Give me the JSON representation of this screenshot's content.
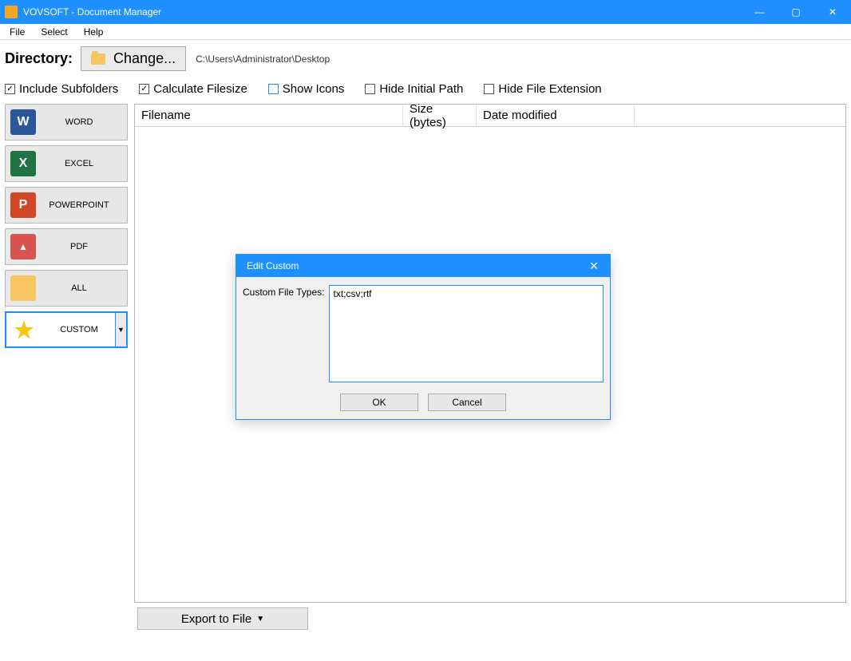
{
  "window": {
    "title": "VOVSOFT - Document Manager"
  },
  "menu": {
    "file": "File",
    "select": "Select",
    "help": "Help"
  },
  "toolbar": {
    "directory_label": "Directory:",
    "change_label": "Change...",
    "path": "C:\\Users\\Administrator\\Desktop"
  },
  "options": {
    "include_subfolders": {
      "label": "Include Subfolders",
      "checked": true
    },
    "calculate_filesize": {
      "label": "Calculate Filesize",
      "checked": true
    },
    "show_icons": {
      "label": "Show Icons",
      "checked": false
    },
    "hide_initial_path": {
      "label": "Hide Initial Path",
      "checked": false
    },
    "hide_file_extension": {
      "label": "Hide File Extension",
      "checked": false
    }
  },
  "sidebar": {
    "items": [
      {
        "label": "WORD",
        "icon": "W"
      },
      {
        "label": "EXCEL",
        "icon": "X"
      },
      {
        "label": "POWERPOINT",
        "icon": "P"
      },
      {
        "label": "PDF",
        "icon": "▲"
      },
      {
        "label": "ALL",
        "icon": ""
      },
      {
        "label": "CUSTOM",
        "icon": "★",
        "selected": true,
        "dropdown": true
      }
    ]
  },
  "table": {
    "columns": {
      "filename": "Filename",
      "size": "Size (bytes)",
      "date": "Date modified"
    },
    "rows": []
  },
  "export_label": "Export to File",
  "dialog": {
    "title": "Edit Custom",
    "field_label": "Custom File Types:",
    "value": "txt;csv;rtf",
    "ok": "OK",
    "cancel": "Cancel"
  }
}
